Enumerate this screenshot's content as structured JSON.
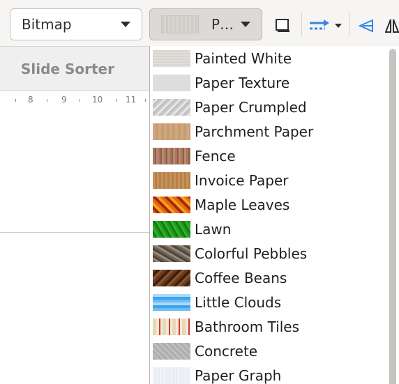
{
  "toolbar": {
    "fill_type": "Bitmap",
    "pattern_selected": "P…",
    "icons": [
      "shadow-box-icon",
      "line-arrow-icon",
      "dropdown-arrow-icon",
      "transform-icon",
      "flip-icon"
    ]
  },
  "left_panel": {
    "slide_sorter_label": "Slide Sorter",
    "ruler_numbers": [
      "8",
      "9",
      "10",
      "11"
    ]
  },
  "dropdown": {
    "items": [
      {
        "label": "Painted White",
        "swatch": "painted-white"
      },
      {
        "label": "Paper Texture",
        "swatch": "paper-texture"
      },
      {
        "label": "Paper Crumpled",
        "swatch": "paper-crumpled"
      },
      {
        "label": "Parchment Paper",
        "swatch": "parchment"
      },
      {
        "label": "Fence",
        "swatch": "fence"
      },
      {
        "label": "Invoice Paper",
        "swatch": "invoice"
      },
      {
        "label": "Maple Leaves",
        "swatch": "maple"
      },
      {
        "label": "Lawn",
        "swatch": "lawn"
      },
      {
        "label": "Colorful Pebbles",
        "swatch": "pebbles"
      },
      {
        "label": "Coffee Beans",
        "swatch": "coffee"
      },
      {
        "label": "Little Clouds",
        "swatch": "clouds"
      },
      {
        "label": "Bathroom Tiles",
        "swatch": "tiles"
      },
      {
        "label": "Concrete",
        "swatch": "concrete"
      },
      {
        "label": "Paper Graph",
        "swatch": "graph"
      }
    ]
  },
  "colors": {
    "accent_blue": "#3584e4",
    "toolbar_bg": "#f6f5f4"
  }
}
